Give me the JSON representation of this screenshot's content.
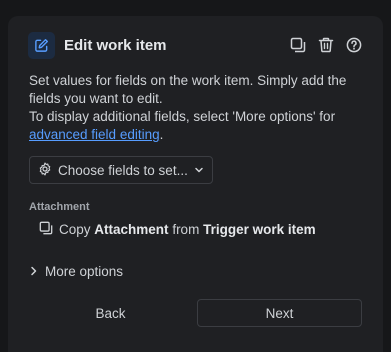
{
  "header": {
    "title": "Edit work item",
    "icons": [
      "edit-icon",
      "duplicate-icon",
      "delete-icon",
      "help-icon"
    ]
  },
  "description": {
    "line1": "Set values for fields on the work item. Simply add the fields you want to edit.",
    "line2_prefix": "To display additional fields, select 'More options' for ",
    "link_text": "advanced field editing",
    "line2_suffix": "."
  },
  "chooser": {
    "label": "Choose fields to set..."
  },
  "field": {
    "label": "Attachment",
    "copy_word": "Copy",
    "source_field": "Attachment",
    "from_word": "from",
    "source": "Trigger work item"
  },
  "more_options": {
    "label": "More options"
  },
  "footer": {
    "back_label": "Back",
    "next_label": "Next"
  },
  "colors": {
    "background": "#161719",
    "panel": "#1f2023",
    "link": "#579dff",
    "icon_tile": "#1c2b41"
  }
}
